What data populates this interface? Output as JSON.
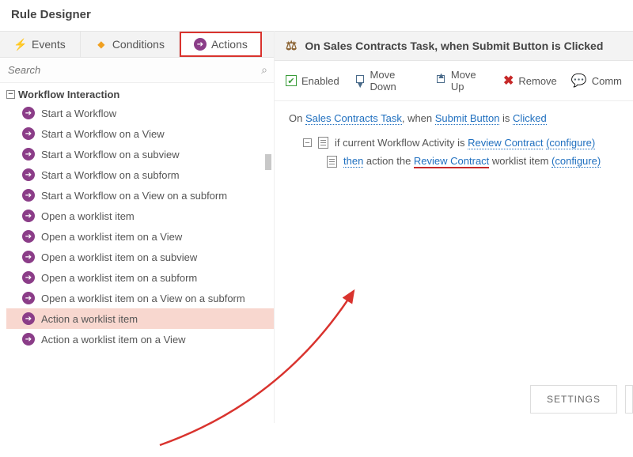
{
  "header": {
    "title": "Rule Designer"
  },
  "tabs": {
    "events": "Events",
    "conditions": "Conditions",
    "actions": "Actions"
  },
  "search": {
    "placeholder": "Search"
  },
  "tree": {
    "category": "Workflow Interaction",
    "items": [
      "Start a Workflow",
      "Start a Workflow on a View",
      "Start a Workflow on a subview",
      "Start a Workflow on a subform",
      "Start a Workflow on a View on a subform",
      "Open a worklist item",
      "Open a worklist item on a View",
      "Open a worklist item on a subview",
      "Open a worklist item on a subform",
      "Open a worklist item on a View on a subform",
      "Action a worklist item",
      "Action a worklist item on a View"
    ],
    "highlighted_index": 10
  },
  "rule_title": "On Sales Contracts Task, when Submit Button is Clicked",
  "toolbar": {
    "enabled": "Enabled",
    "movedown": "Move Down",
    "moveup": "Move Up",
    "remove": "Remove",
    "comment": "Comm"
  },
  "sentence": {
    "prefix": "On ",
    "link1": "Sales Contracts Task",
    "mid1": ", when ",
    "link2": "Submit Button",
    "mid2": " is ",
    "link3": "Clicked"
  },
  "condition": {
    "text1": "if current Workflow Activity is ",
    "link1": "Review Contract",
    "conf": "(configure)"
  },
  "action": {
    "then": "then",
    "mid": " action the ",
    "link": "Review Contract",
    "tail": " worklist item ",
    "conf": "(configure)"
  },
  "footer": {
    "settings": "SETTINGS"
  }
}
